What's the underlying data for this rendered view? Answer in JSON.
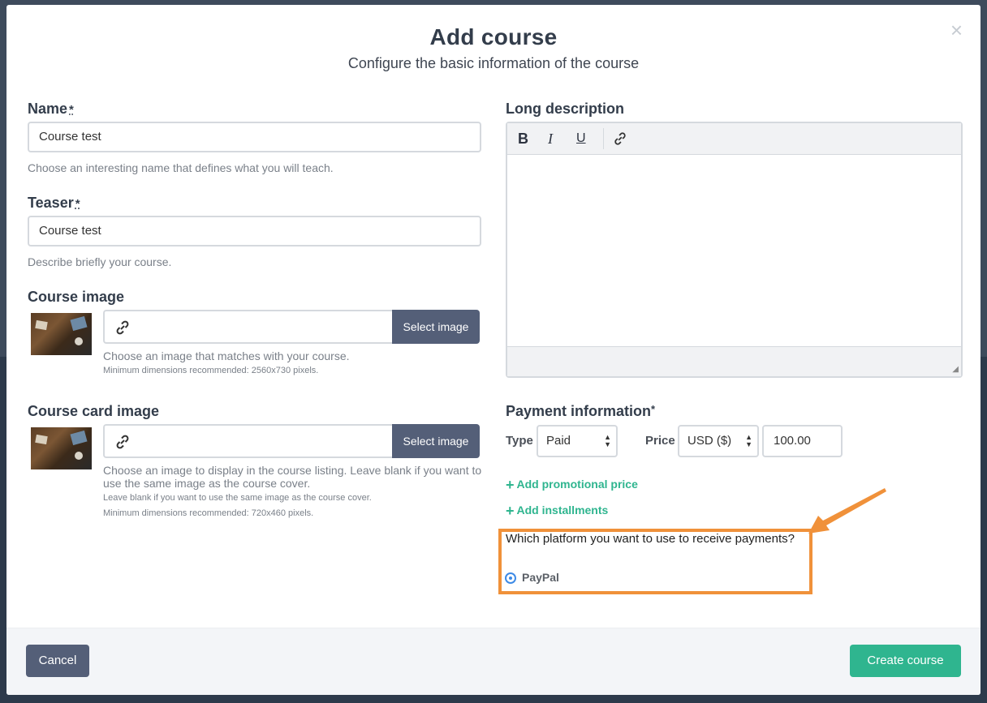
{
  "modal": {
    "title": "Add course",
    "subtitle": "Configure the basic information of the course",
    "close_glyph": "×"
  },
  "name": {
    "label": "Name",
    "required_mark": "*",
    "value": "Course test",
    "help": "Choose an interesting name that defines what you will teach."
  },
  "teaser": {
    "label": "Teaser",
    "required_mark": "*",
    "value": "Course test",
    "help": "Describe briefly your course."
  },
  "course_image": {
    "label": "Course image",
    "button": "Select image",
    "help": "Choose an image that matches with your course.",
    "help_small": "Minimum dimensions recommended: 2560x730 pixels."
  },
  "card_image": {
    "label": "Course card image",
    "button": "Select image",
    "help": "Choose an image to display in the course listing. Leave blank if you want to use the same image as the course cover.",
    "help_small_1": "Leave blank if you want to use the same image as the course cover.",
    "help_small_2": "Minimum dimensions recommended: 720x460 pixels."
  },
  "long_description": {
    "label": "Long description",
    "toolbar": {
      "bold": "B",
      "italic": "I",
      "underline": "U"
    }
  },
  "payment": {
    "label": "Payment information",
    "required_mark": "*",
    "type_label": "Type",
    "type_value": "Paid",
    "price_label": "Price",
    "currency_value": "USD ($)",
    "price_value": "100.00",
    "add_promo": "Add promotional price",
    "add_installments": "Add installments",
    "platform_question": "Which platform you want to use to receive payments?",
    "platform_option": "PayPal"
  },
  "footer": {
    "cancel": "Cancel",
    "create": "Create course"
  },
  "colors": {
    "primary_dark": "#545f78",
    "accent_green": "#2fb58f",
    "highlight_orange": "#f0913a"
  }
}
